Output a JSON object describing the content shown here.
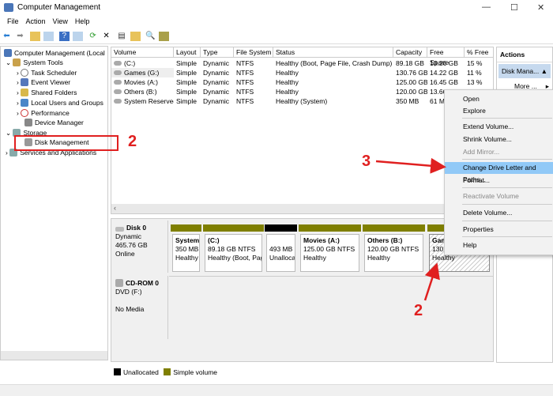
{
  "window": {
    "title": "Computer Management",
    "controls": [
      "—",
      "☐",
      "✕"
    ]
  },
  "menu": [
    "File",
    "Action",
    "View",
    "Help"
  ],
  "toolbar": [
    "back",
    "forward",
    "up",
    "show-hide-tree",
    "help",
    "show-hide-action",
    "refresh",
    "delete",
    "properties",
    "open",
    "search",
    "settings"
  ],
  "tree": {
    "root": "Computer Management (Local",
    "items": [
      {
        "label": "System Tools"
      },
      {
        "label": "Task Scheduler"
      },
      {
        "label": "Event Viewer"
      },
      {
        "label": "Shared Folders"
      },
      {
        "label": "Local Users and Groups"
      },
      {
        "label": "Performance"
      },
      {
        "label": "Device Manager"
      },
      {
        "label": "Storage"
      },
      {
        "label": "Disk Management"
      },
      {
        "label": "Services and Applications"
      }
    ]
  },
  "volumes": {
    "columns": [
      "Volume",
      "Layout",
      "Type",
      "File System",
      "Status",
      "Capacity",
      "Free Space",
      "% Free"
    ],
    "rows": [
      [
        "(C:)",
        "Simple",
        "Dynamic",
        "NTFS",
        "Healthy (Boot, Page File, Crash Dump)",
        "89.18 GB",
        "13.26 GB",
        "15 %"
      ],
      [
        "Games (G:)",
        "Simple",
        "Dynamic",
        "NTFS",
        "Healthy",
        "130.76 GB",
        "14.22 GB",
        "11 %"
      ],
      [
        "Movies (A:)",
        "Simple",
        "Dynamic",
        "NTFS",
        "Healthy",
        "125.00 GB",
        "16.45 GB",
        "13 %"
      ],
      [
        "Others (B:)",
        "Simple",
        "Dynamic",
        "NTFS",
        "Healthy",
        "120.00 GB",
        "13.66 GB",
        "11 %"
      ],
      [
        "System Reserved",
        "Simple",
        "Dynamic",
        "NTFS",
        "Healthy (System)",
        "350 MB",
        "61 MB",
        ""
      ]
    ]
  },
  "disks": [
    {
      "name": "Disk 0",
      "type": "Dynamic",
      "size": "465.76 GB",
      "state": "Online",
      "partitions": [
        {
          "name": "System",
          "size": "350 MB",
          "status": "Healthy"
        },
        {
          "name": "(C:)",
          "size": "89.18 GB NTFS",
          "status": "Healthy (Boot, Pag"
        },
        {
          "name": "",
          "size": "493 MB",
          "status": "Unalloca"
        },
        {
          "name": "Movies  (A:)",
          "size": "125.00 GB NTFS",
          "status": "Healthy"
        },
        {
          "name": "Others  (B:)",
          "size": "120.00 GB NTFS",
          "status": "Healthy"
        },
        {
          "name": "Gam",
          "size": "130.7",
          "status": "Healthy"
        }
      ]
    },
    {
      "name": "CD-ROM 0",
      "type": "DVD (F:)",
      "state": "No Media"
    }
  ],
  "legend": [
    "Unallocated",
    "Simple volume"
  ],
  "colors": {
    "unallocated": "#000000",
    "simple": "#7f7f00",
    "highlight": "#91c9f7",
    "annotation": "#e02020"
  },
  "actions": {
    "header": "Actions",
    "section": "Disk Mana...",
    "more": "More ..."
  },
  "context_menu": [
    {
      "label": "Open"
    },
    {
      "label": "Explore"
    },
    {
      "label": "Extend Volume..."
    },
    {
      "label": "Shrink Volume..."
    },
    {
      "label": "Add Mirror...",
      "disabled": true
    },
    {
      "label": "Change Drive Letter and Paths...",
      "highlighted": true
    },
    {
      "label": "Format..."
    },
    {
      "label": "Reactivate Volume",
      "disabled": true
    },
    {
      "label": "Delete Volume..."
    },
    {
      "label": "Properties"
    },
    {
      "label": "Help"
    }
  ],
  "annotations": [
    "2",
    "3",
    "2"
  ]
}
